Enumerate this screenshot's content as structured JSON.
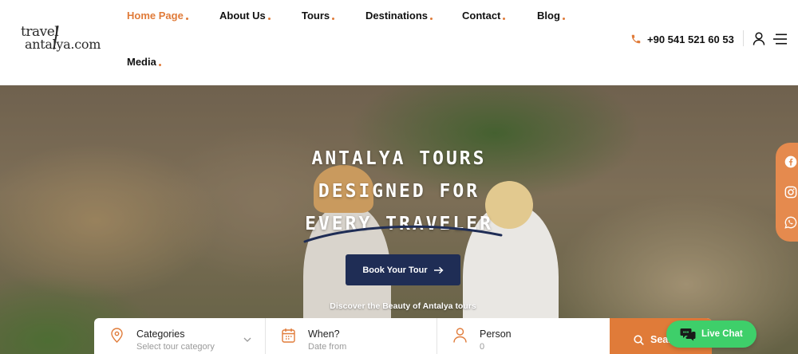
{
  "brand": {
    "logo_line1": "travel",
    "logo_line2": "antalya.com"
  },
  "nav": {
    "items": [
      {
        "label": "Home Page",
        "active": true
      },
      {
        "label": "About Us",
        "active": false
      },
      {
        "label": "Tours",
        "active": false
      },
      {
        "label": "Destinations",
        "active": false
      },
      {
        "label": "Contact",
        "active": false
      },
      {
        "label": "Blog",
        "active": false
      },
      {
        "label": "Media",
        "active": false
      }
    ]
  },
  "header": {
    "phone": "+90 541 521 60 53",
    "icons": [
      "phone-icon",
      "user-icon",
      "menu-icon"
    ]
  },
  "hero": {
    "title_line1": "ANTALYA TOURS",
    "title_line2": "DESIGNED FOR",
    "title_line3": "EVERY TRAVELER",
    "cta_label": "Book Your Tour",
    "subtitle": "Discover the Beauty of Antalya tours"
  },
  "social": {
    "icons": [
      "facebook-icon",
      "instagram-icon",
      "whatsapp-icon"
    ]
  },
  "search": {
    "categories_label": "Categories",
    "categories_placeholder": "Select tour category",
    "when_label": "When?",
    "when_placeholder": "Date from",
    "person_label": "Person",
    "person_value": "0",
    "button_label": "Search"
  },
  "chat": {
    "label": "Live Chat"
  },
  "colors": {
    "accent": "#e07b39",
    "navy": "#1f2d55",
    "chat_green": "#3ecf6a",
    "social_bg": "#e58a4e"
  }
}
